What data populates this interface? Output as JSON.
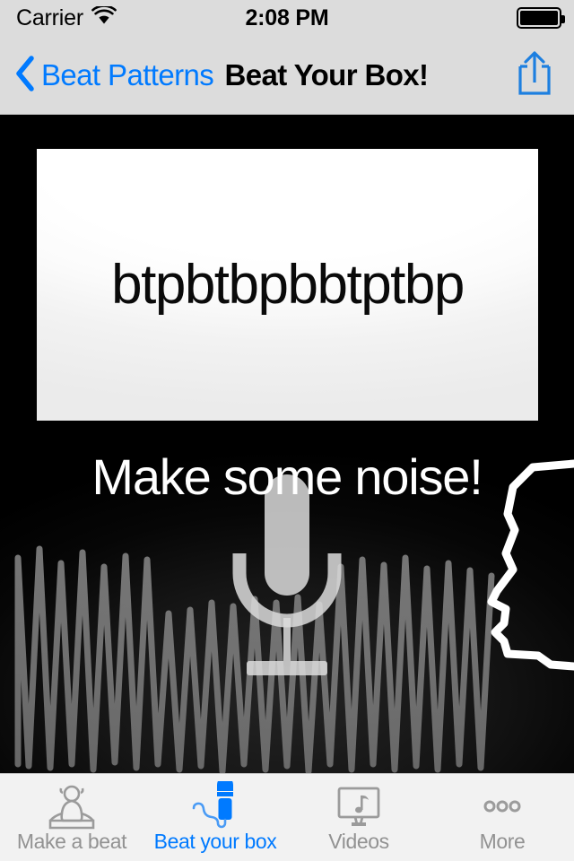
{
  "status_bar": {
    "carrier": "Carrier",
    "wifi_icon": "wifi-icon",
    "time": "2:08 PM",
    "battery_icon": "battery-full-icon"
  },
  "nav_bar": {
    "back_icon": "chevron-left-icon",
    "back_label": "Beat Patterns",
    "title": "Beat Your Box!",
    "share_icon": "share-icon"
  },
  "main": {
    "pattern_text": "btpbtbpbbtptbp",
    "noise_prompt": "Make some noise!",
    "mic_icon": "microphone-icon",
    "waveform_icon": "audio-waveform-icon",
    "face_icon": "face-profile-icon"
  },
  "tab_bar": {
    "tabs": [
      {
        "label": "Make a beat",
        "icon": "person-sitting-icon",
        "active": false
      },
      {
        "label": "Beat your box",
        "icon": "handheld-microphone-icon",
        "active": true
      },
      {
        "label": "Videos",
        "icon": "tv-music-note-icon",
        "active": false
      },
      {
        "label": "More",
        "icon": "ellipsis-icon",
        "active": false
      }
    ]
  },
  "colors": {
    "accent": "#007aff",
    "chrome": "#dcdcdc",
    "tabbar": "#f2f2f2",
    "inactive_tab": "#929292",
    "stage": "#000000"
  }
}
